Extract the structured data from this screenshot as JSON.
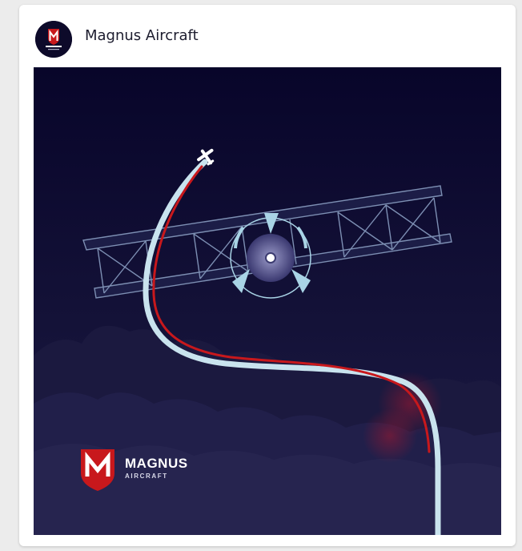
{
  "post": {
    "account_name": "Magnus Aircraft",
    "avatar_icon": "magnus-logo-icon",
    "image": {
      "brand_name": "MAGNUS",
      "brand_subtitle": "AIRCRAFT",
      "logo_letter": "M"
    }
  },
  "colors": {
    "page_background": "#ececec",
    "card_background": "#ffffff",
    "image_background": "#0d0a2e",
    "brand_red": "#c8181c",
    "trail_light": "#c9e3ee"
  }
}
